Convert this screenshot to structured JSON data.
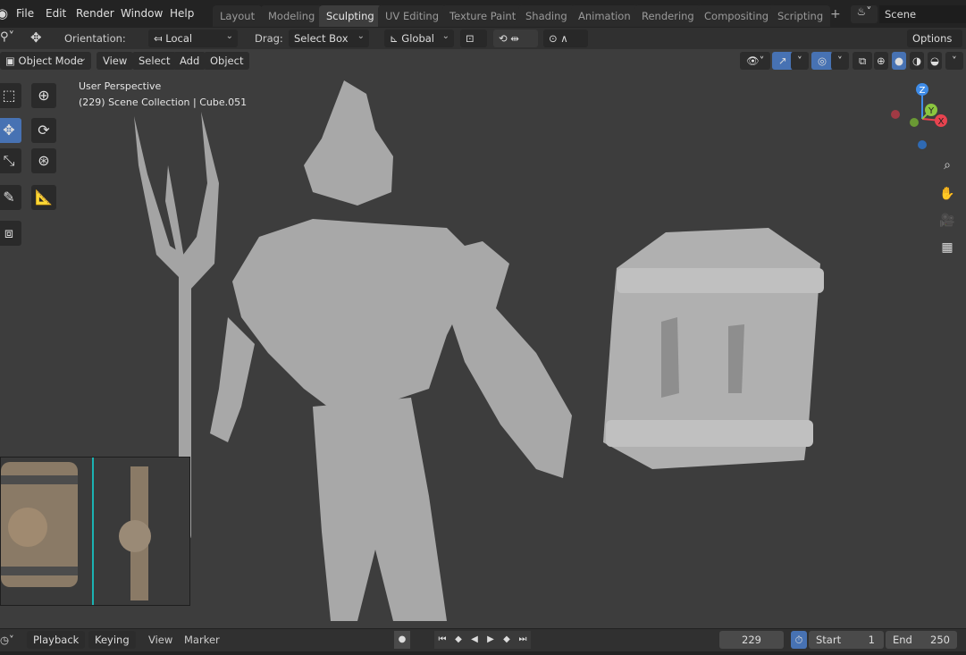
{
  "topbar": {
    "menus": [
      "File",
      "Edit",
      "Render",
      "Window",
      "Help"
    ],
    "workspaces": [
      "Layout",
      "Modeling",
      "Sculpting",
      "UV Editing",
      "Texture Paint",
      "Shading",
      "Animation",
      "Rendering",
      "Compositing",
      "Scripting"
    ],
    "active_workspace": "Sculpting",
    "add_workspace": "+",
    "scene": "Scene"
  },
  "toolheader": {
    "orientation_label": "Orientation:",
    "orientation_value": "Local",
    "drag_label": "Drag:",
    "drag_value": "Select Box",
    "transform_orientation": "Global",
    "options": "Options"
  },
  "viewport_header": {
    "mode": "Object Mode",
    "menus": [
      "View",
      "Select",
      "Add",
      "Object"
    ]
  },
  "viewport": {
    "perspective": "User Perspective",
    "collection": "(229) Scene Collection | Cube.051",
    "gizmo_axes": {
      "z": "Z",
      "y": "Y",
      "x": "X"
    },
    "colors": {
      "x": "#e8434f",
      "y": "#8bc63f",
      "z": "#3f8ce8",
      "active": "#4772b3"
    }
  },
  "timeline": {
    "menus": [
      "Playback",
      "Keying",
      "View",
      "Marker"
    ],
    "current_frame": "229",
    "start_label": "Start",
    "start": "1",
    "end_label": "End",
    "end": "250"
  }
}
